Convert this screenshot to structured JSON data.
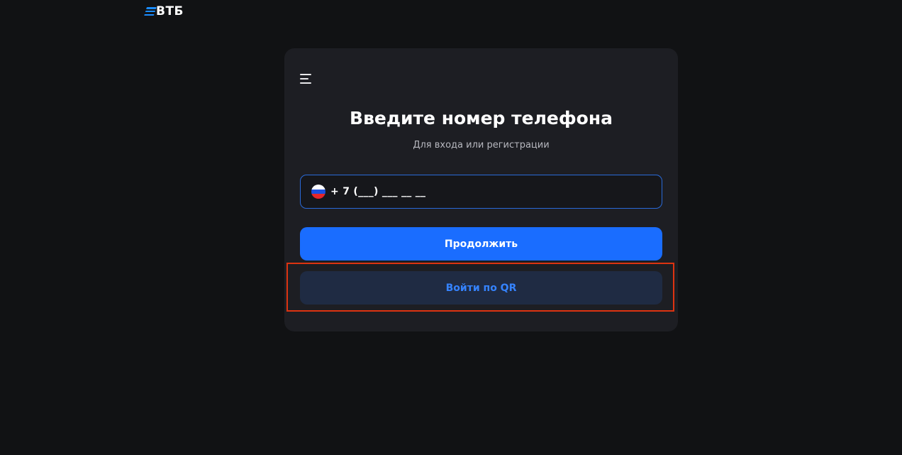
{
  "brand": {
    "logo_text": "ВТБ",
    "logo_icon": "vtb-stripes-icon",
    "accent_color": "#1a8cff"
  },
  "card": {
    "menu_icon": "menu-icon",
    "title": "Введите номер телефона",
    "subtitle": "Для входа или регистрации",
    "phone": {
      "country_flag": "russia-flag-icon",
      "placeholder": "+ 7 (___) ___ __ __",
      "value": "",
      "border_color": "#2a6ad9"
    },
    "continue_button": {
      "label": "Продолжить",
      "color": "#1a6dff"
    },
    "qr_button": {
      "label": "Войти по QR",
      "color": "#3583ff",
      "background": "#1f2b43"
    }
  },
  "highlight": {
    "color": "#dd3311"
  }
}
